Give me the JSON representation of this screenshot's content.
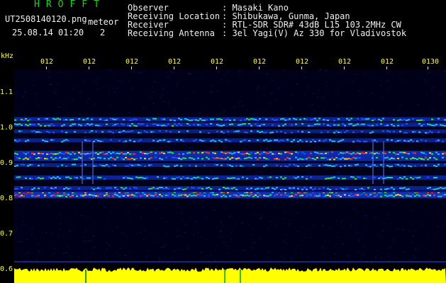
{
  "app": {
    "name": "HROFFT"
  },
  "file": {
    "name": "UT2508140120.png",
    "type_label": "meteor",
    "datetime": "25.08.14 01:20",
    "page_indicator": "2"
  },
  "info": {
    "observer_label": "Observer",
    "observer_value": ": Masaki Kano",
    "location_label": "Receiving Location",
    "location_value": ": Shibukawa, Gunma, Japan",
    "receiver_label": "Receiver",
    "receiver_value": ": RTL-SDR SDR# 43dB L15 103.2MHz CW",
    "antenna_label": "Receiving Antenna",
    "antenna_value": ": 3el Yagi(V) Az 330 for Vladivostok"
  },
  "axis": {
    "unit": "kHz",
    "time_labels": [
      "012",
      "012",
      "012",
      "012",
      "012",
      "012",
      "012",
      "012",
      "012",
      "0130"
    ],
    "freq_labels": [
      "1.1",
      "1.0",
      "0.9",
      "0.8",
      "0.7",
      "0.6"
    ],
    "freq_values": [
      1.1,
      1.0,
      0.9,
      0.8,
      0.7,
      0.6
    ]
  },
  "colors": {
    "text": "#ffffff",
    "app_title": "#19d219",
    "axis_yellow": "#ffff30",
    "background": "#000018",
    "power_fill": "#ffff00"
  },
  "spectrogram": {
    "bands": [
      {
        "freq": 1.025,
        "intensity": 0.55
      },
      {
        "freq": 1.01,
        "intensity": 0.5
      },
      {
        "freq": 0.99,
        "intensity": 0.35
      },
      {
        "freq": 0.965,
        "intensity": 0.45
      },
      {
        "freq": 0.93,
        "intensity": 0.95
      },
      {
        "freq": 0.915,
        "intensity": 0.8
      },
      {
        "freq": 0.895,
        "intensity": 0.4
      },
      {
        "freq": 0.86,
        "intensity": 0.55
      },
      {
        "freq": 0.83,
        "intensity": 0.5
      },
      {
        "freq": 0.815,
        "intensity": 1.0
      },
      {
        "freq": 0.81,
        "intensity": 0.85
      }
    ]
  }
}
